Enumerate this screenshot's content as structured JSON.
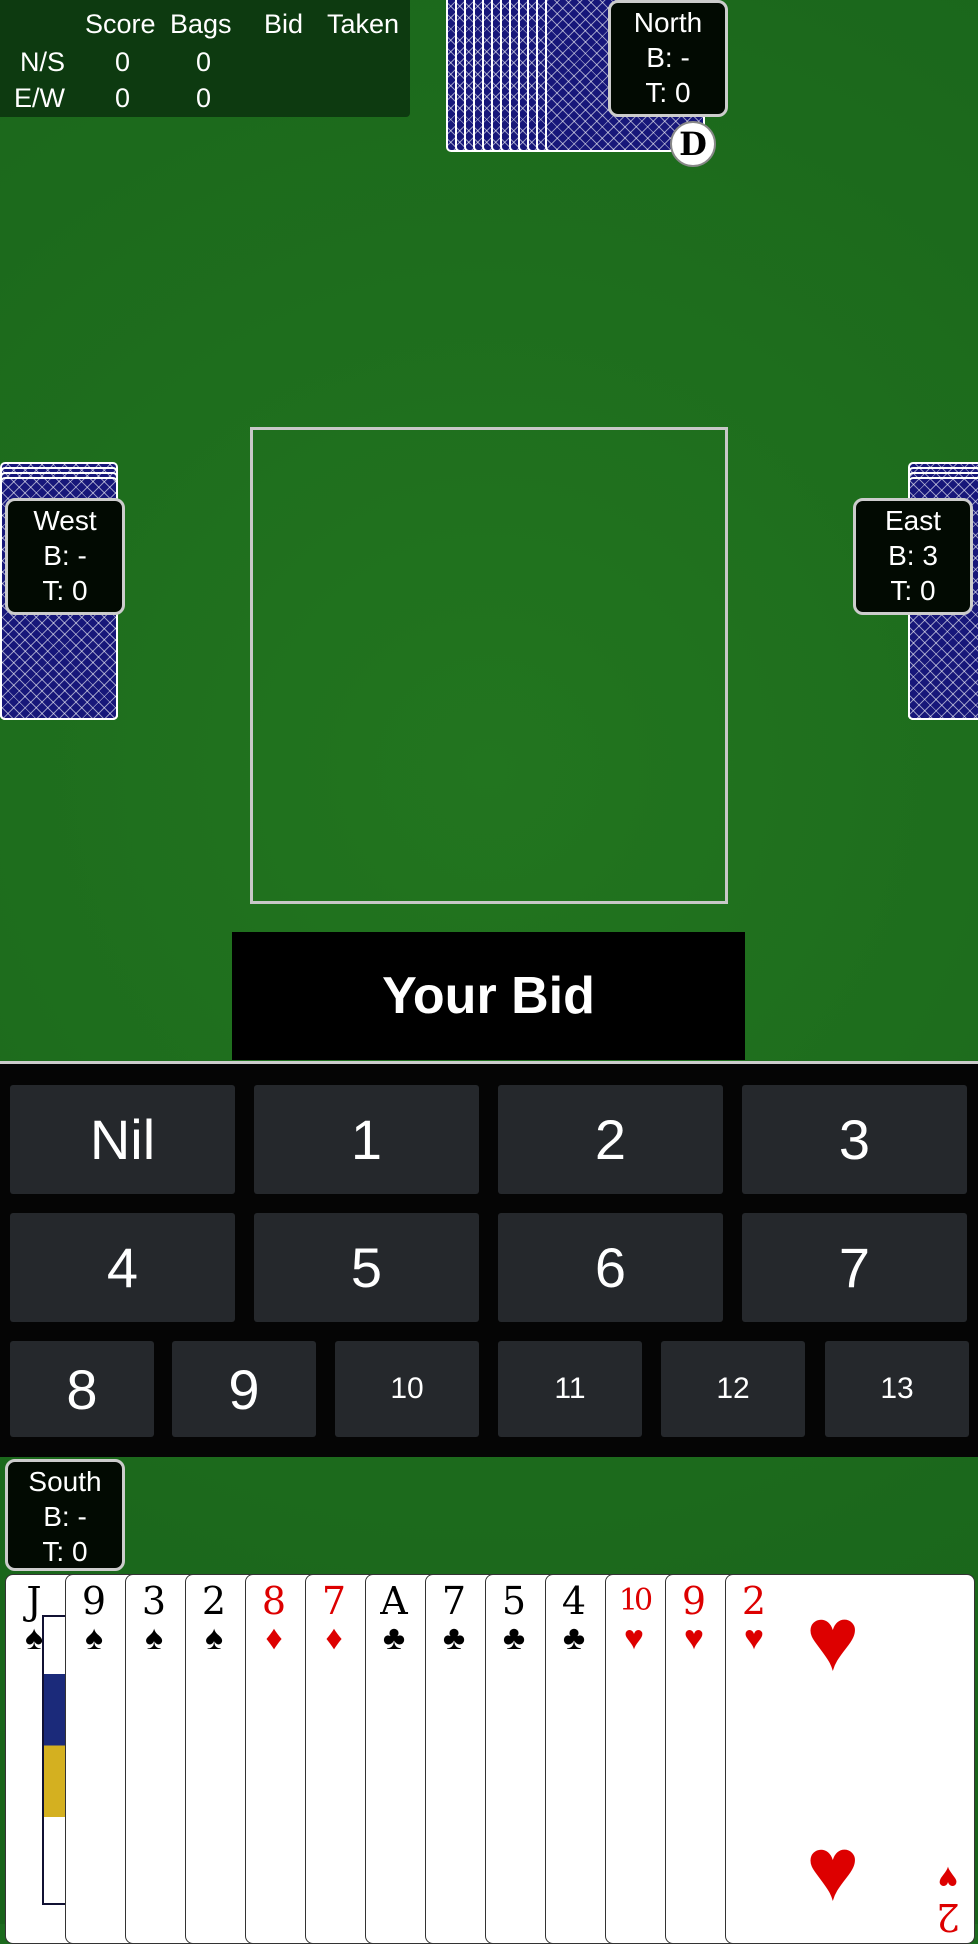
{
  "scoreboard": {
    "headers": [
      "Score",
      "Bags",
      "Bid",
      "Taken"
    ],
    "rows": [
      {
        "team": "N/S",
        "score": "0",
        "bags": "0"
      },
      {
        "team": "E/W",
        "score": "0",
        "bags": "0"
      }
    ]
  },
  "players": {
    "north": {
      "name": "North",
      "bid": "B: -",
      "taken": "T: 0"
    },
    "west": {
      "name": "West",
      "bid": "B: -",
      "taken": "T: 0"
    },
    "east": {
      "name": "East",
      "bid": "B: 3",
      "taken": "T: 0"
    },
    "south": {
      "name": "South",
      "bid": "B: -",
      "taken": "T: 0"
    }
  },
  "dealer_badge": "D",
  "prompt": "Your Bid",
  "bid_options": [
    "Nil",
    "1",
    "2",
    "3",
    "4",
    "5",
    "6",
    "7",
    "8",
    "9",
    "10",
    "11",
    "12",
    "13"
  ],
  "hand": [
    {
      "rank": "J",
      "suit": "♠"
    },
    {
      "rank": "9",
      "suit": "♠"
    },
    {
      "rank": "3",
      "suit": "♠"
    },
    {
      "rank": "2",
      "suit": "♠"
    },
    {
      "rank": "8",
      "suit": "♦"
    },
    {
      "rank": "7",
      "suit": "♦"
    },
    {
      "rank": "A",
      "suit": "♣"
    },
    {
      "rank": "7",
      "suit": "♣"
    },
    {
      "rank": "5",
      "suit": "♣"
    },
    {
      "rank": "4",
      "suit": "♣"
    },
    {
      "rank": "10",
      "suit": "♥"
    },
    {
      "rank": "9",
      "suit": "♥"
    },
    {
      "rank": "2",
      "suit": "♥"
    }
  ],
  "colors": {
    "felt": "#1c6b1e",
    "card_back": "#17177a",
    "red_suit": "#dd0000",
    "button": "#25282c"
  }
}
